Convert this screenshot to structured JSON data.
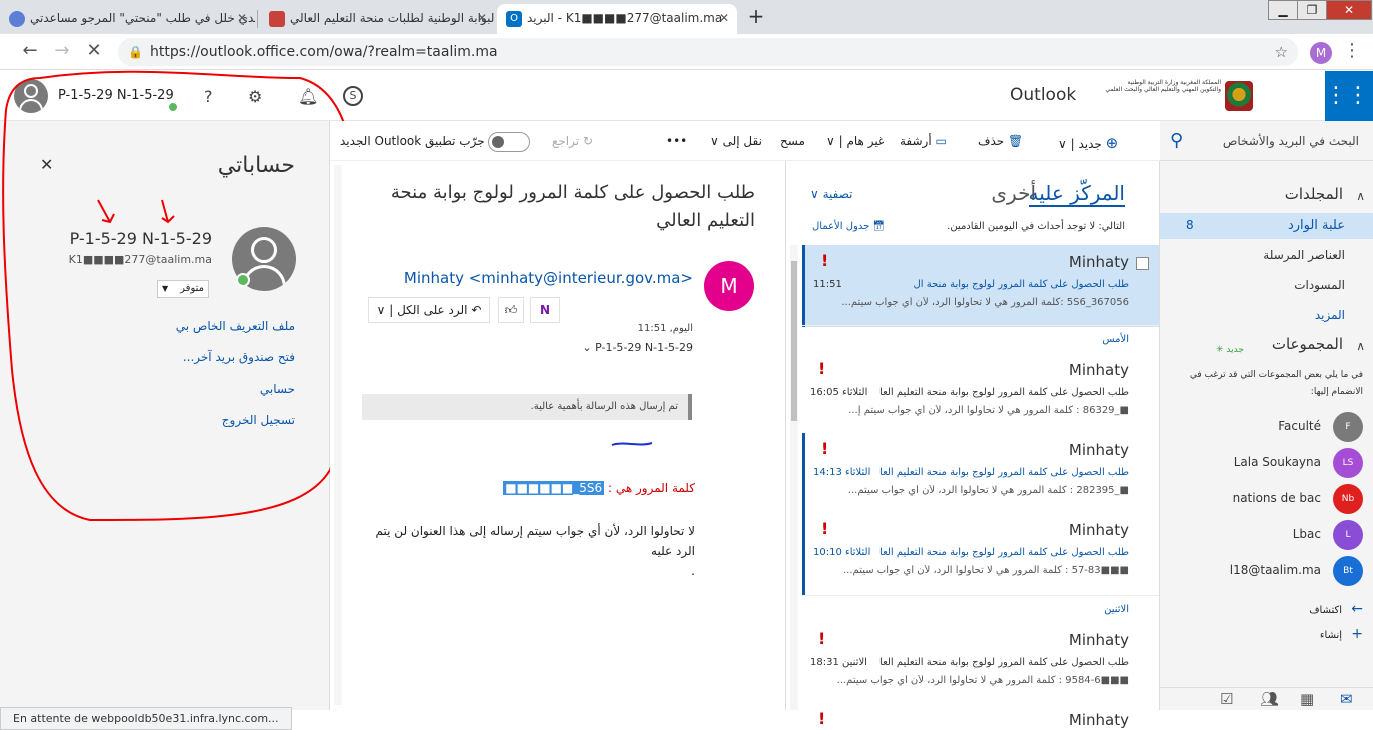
{
  "browser": {
    "tabs": [
      {
        "title": "لدي خلل في طلب \"منحتي\" المرجو مساعدتي",
        "active": false
      },
      {
        "title": "البوابة الوطنية لطلبات منحة التعليم العالي::",
        "active": false
      },
      {
        "title": "البريد - K1■■■■277@taalim.ma",
        "active": true
      }
    ],
    "url": "https://outlook.office.com/owa/?realm=taalim.ma",
    "profile_initial": "M",
    "status_text": "En attente de webpooldb50e31.infra.lync.com..."
  },
  "header": {
    "account_name": "P-1-5-29 N-1-5-29",
    "brand": "Outlook",
    "ministry_text": "المملكة المغربية وزارة التربية الوطنية والتكوين المهني والتعليم العالي والبحث العلمي",
    "icons": [
      "help-icon",
      "gear-icon",
      "bell-icon",
      "skype-icon",
      "app-launcher-icon"
    ]
  },
  "account_panel": {
    "title": "حساباتي",
    "name": "P-1-5-29 N-1-5-29",
    "email": "K1■■■■277@taalim.ma",
    "status": "متوفر",
    "links": [
      "ملف التعريف الخاص بي",
      "فتح صندوق بريد آخر...",
      "حسابي",
      "تسجيل الخروج"
    ]
  },
  "command_bar": {
    "new": "جديد",
    "delete": "حذف",
    "archive": "أرشفة",
    "junk": "غير هام",
    "sweep": "مسح",
    "move": "نقل إلى",
    "more": "•••",
    "undo": "تراجع",
    "try_new": "جرّب تطبيق Outlook الجديد"
  },
  "reading_pane": {
    "subject": "طلب الحصول على كلمة المرور لولوج بوابة منحة التعليم العالي",
    "sender_initial": "M",
    "from": "Minhaty <minhaty@interieur.gov.ma>",
    "reply_all": "الرد على الكل",
    "date": "اليوم, 11:51",
    "to": "P-1-5-29 N-1-5-29",
    "importance_note": "تم إرسال هذه الرسالة بأهمية عالية.",
    "password_label": "كلمة المرور هي :",
    "password_value": "5S6_■■■■■■",
    "body_note": "لا تحاولوا الرد، لأن أي جواب سيتم إرساله إلى هذا العنوان لن يتم الرد عليه",
    "body_end": "."
  },
  "message_list": {
    "tab_focused": "المركّز عليه",
    "tab_other": "أخرى",
    "filter": "تصفية",
    "next_events": "التالي: لا توجد أحداث في اليومين القادمين.",
    "agenda": "جدول الأعمال",
    "groups": [
      {
        "label": "",
        "messages": [
          {
            "sender": "Minhaty",
            "subject": "طلب الحصول على كلمة المرور لولوج بوابة منحة ال",
            "time": "11:51",
            "preview": "5S6_367056 :كلمة المرور هي  لا تحاولوا الرد، لأن أي جواب سيتم...",
            "selected": true,
            "unread": true
          }
        ]
      },
      {
        "label": "الأمس",
        "messages": [
          {
            "sender": "Minhaty",
            "subject": "طلب الحصول على كلمة المرور لولوج بوابة منحة التعليم العال",
            "time": "الثلاثاء 16:05",
            "preview": "■_86329 : كلمة المرور هي  لا تحاولوا الرد، لأن أي جواب سيتم إ...",
            "selected": false,
            "unread": false
          },
          {
            "sender": "Minhaty",
            "subject": "طلب الحصول على كلمة المرور لولوج بوابة منحة التعليم العال",
            "time": "الثلاثاء 14:13",
            "preview": "■_282395 : كلمة المرور هي  لا تحاولوا الرد، لأن أي جواب سيتم...",
            "selected": false,
            "unread": true
          },
          {
            "sender": "Minhaty",
            "subject": "طلب الحصول على كلمة المرور لولوج بوابة منحة التعليم العال",
            "time": "الثلاثاء 10:10",
            "preview": "■■■57-83 : كلمة المرور هي  لا تحاولوا الرد، لأن أي جواب سيتم...",
            "selected": false,
            "unread": true
          }
        ]
      },
      {
        "label": "الاثنين",
        "messages": [
          {
            "sender": "Minhaty",
            "subject": "طلب الحصول على كلمة المرور لولوج بوابة منحة التعليم العال",
            "time": "الاثنين 18:31",
            "preview": "■■■9584-6 : كلمة المرور هي  لا تحاولوا الرد، لأن أي جواب سيتم...",
            "selected": false,
            "unread": false
          },
          {
            "sender": "Minhaty",
            "subject": "",
            "time": "",
            "preview": "",
            "selected": false,
            "unread": false
          }
        ]
      }
    ]
  },
  "nav_pane": {
    "search_label": "البحث في البريد والأشخاص",
    "folders_title": "المجلدات",
    "folders": [
      {
        "name": "علبة الوارد",
        "count": "8",
        "selected": true
      },
      {
        "name": "العناصر المرسلة",
        "count": "",
        "selected": false
      },
      {
        "name": "المسودات",
        "count": "",
        "selected": false
      },
      {
        "name": "المزيد",
        "count": "",
        "selected": false
      }
    ],
    "groups_title": "المجموعات",
    "groups_new": "جديد",
    "groups_hint": "في ما يلي بعض المجموعات التي قد ترغب في الانضمام إليها:",
    "groups": [
      {
        "name": "Faculté",
        "initials": "F",
        "color": "#7a7a7a"
      },
      {
        "name": "Lala Soukayna",
        "initials": "LS",
        "color": "#a64dd6"
      },
      {
        "name": "nations de bac",
        "initials": "Nb",
        "color": "#e0201e"
      },
      {
        "name": "Lbac",
        "initials": "L",
        "color": "#8a4dd6"
      },
      {
        "name": "l18@taalim.ma",
        "initials": "Bt",
        "color": "#1a6fd6"
      }
    ],
    "discover": "اكتشاف",
    "create": "إنشاء"
  }
}
